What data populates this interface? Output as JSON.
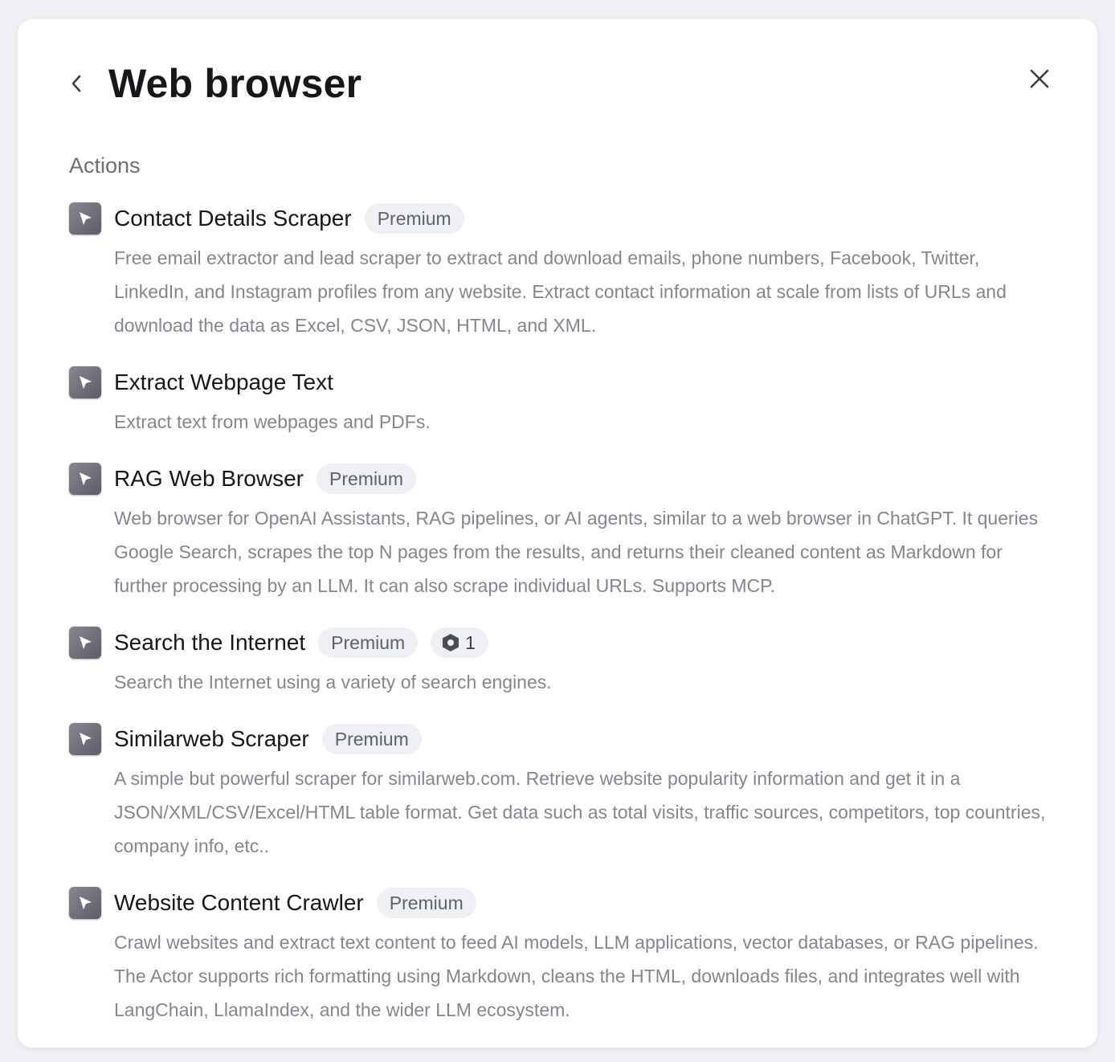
{
  "header": {
    "title": "Web browser",
    "back_icon": "chevron-left-icon",
    "close_icon": "close-icon"
  },
  "section": {
    "label": "Actions"
  },
  "items": [
    {
      "title": "Contact Details Scraper",
      "badge": "Premium",
      "description": "Free email extractor and lead scraper to extract and download emails, phone numbers, Facebook, Twitter, LinkedIn, and Instagram profiles from any website. Extract contact information at scale from lists of URLs and download the data as Excel, CSV, JSON, HTML, and XML."
    },
    {
      "title": "Extract Webpage Text",
      "badge": null,
      "description": "Extract text from webpages and PDFs."
    },
    {
      "title": "RAG Web Browser",
      "badge": "Premium",
      "description": "Web browser for OpenAI Assistants, RAG pipelines, or AI agents, similar to a web browser in ChatGPT. It queries Google Search, scrapes the top N pages from the results, and returns their cleaned content as Markdown for further processing by an LLM. It can also scrape individual URLs. Supports MCP."
    },
    {
      "title": "Search the Internet",
      "badge": "Premium",
      "count": "1",
      "count_icon": "hexagon-icon",
      "description": "Search the Internet using a variety of search engines."
    },
    {
      "title": "Similarweb Scraper",
      "badge": "Premium",
      "description": "A simple but powerful scraper for similarweb.com. Retrieve website popularity information and get it in a JSON/XML/CSV/Excel/HTML table format. Get data such as total visits, traffic sources, competitors, top countries, company info, etc.."
    },
    {
      "title": "Website Content Crawler",
      "badge": "Premium",
      "description": "Crawl websites and extract text content to feed AI models, LLM applications, vector databases, or RAG pipelines. The Actor supports rich formatting using Markdown, cleans the HTML, downloads files, and integrates well with LangChain, LlamaIndex, and the wider LLM ecosystem."
    }
  ],
  "colors": {
    "background": "#eff0f4",
    "panel": "#ffffff",
    "title": "#16171b",
    "muted": "#83868d",
    "badge_bg": "#eff0f3",
    "icon_bg": "#6f6a78"
  }
}
